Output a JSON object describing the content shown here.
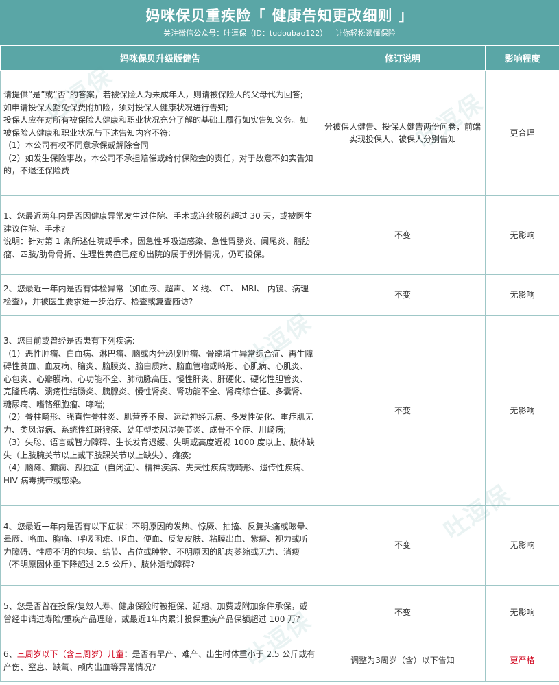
{
  "header": {
    "title": "妈咪保贝重疾险「 健康告知更改细则 」",
    "subtitle_follow": "关注微信公众号：吐逗保（ID：tudoubao122）",
    "subtitle_slogan": "让你轻松读懂保险"
  },
  "table": {
    "columns": [
      "妈咪保贝升级版健告",
      "修订说明",
      "影响程度"
    ],
    "rows": [
      {
        "lines": [
          "请提供“是”或“否”的答案，若被保险人为未成年人，则请被保险人的父母代为回答;",
          "如申请投保人豁免保费附加险，须对投保人健康状况进行告知;",
          "投保人应在对所有被保险人健康和职业状况充分了解的基础上履行如实告知义务。如被保险人健康和职业状况与下述告知内容不符:",
          "（1）本公司有权不同意承保或解除合同",
          "（2）如发生保险事故，本公司不承担赔偿或给付保险金的责任，对于故意不如实告知的，不退还保险费"
        ],
        "note": "分被保人健告、投保人健告两份问卷，前端实现投保人、被保人分别告知",
        "impact": "更合理"
      },
      {
        "lines": [
          "1、您最近两年内是否因健康异常发生过住院、手术或连续服药超过 30 天，或被医生建议住院、手术?",
          "说明：针对第 1 条所述住院或手术，因急性呼吸道感染、急性胃肠炎、阑尾炎、脂肪瘤、四肢/肋骨骨折、生理性黄疸已痊愈出院的属于例外情况，仍可投保。"
        ],
        "note": "不变",
        "impact": "无影响"
      },
      {
        "lines": [
          "2、您最近一年内是否有体检异常（如血液、超声、 X 线、 CT、 MRI、 内镜、病理检查），并被医生要求进一步治疗、检查或复查随访?"
        ],
        "note": "不变",
        "impact": "无影响"
      },
      {
        "lines": [
          "3、您目前或曾经是否患有下列疾病:",
          "（1）恶性肿瘤、白血病、淋巴瘤、脑或内分泌腺肿瘤、骨髓增生异常综合症、再生障碍性贫血、血友病、脑炎、脑膜炎、脑白质病、脑血管瘤或畸形、心肌病、心肌炎、心包炎、心瓣膜病、心功能不全、肺动脉高压、慢性肝炎、肝硬化、硬化性胆管炎、克隆氏病、溃疡性结肠炎、胰腺炎、慢性肾炎、肾功能不全、肾病综合征、多囊肾、糖尿病、嗜铬细胞瘤、哮喘;",
          "（2）脊柱畸形、强直性脊柱炎、肌营养不良、运动神经元病、多发性硬化、重症肌无力、类风湿病、系统性红斑狼疮、幼年型类风湿关节炎、成骨不全症、川崎病;",
          "（3）失聪、语言或智力障碍、生长发育迟缓、失明或高度近视 1000 度以上、肢体缺失（上肢腕关节以上或下肢踝关节以上缺失）、瘫痪;",
          "（4）脑瘫、癫痫、孤独症（自闭症）、精神疾病、先天性疾病或畸形、遗传性疾病、HIV 病毒携带或感染。"
        ],
        "note": "不变",
        "impact": "无影响"
      },
      {
        "lines": [
          "4、您最近一年内是否有以下症状：不明原因的发热、惊厥、抽搐、反复头痛或眩晕、晕厥、咯血、胸痛、呼吸困难、呕血、便血、反复皮肤、粘膜出血、紫癜、视力或听力障碍、性质不明的包块、结节、占位或肿物、不明原因的肌肉萎缩或无力、消瘦（不明原因体重下降超过 2.5 公斤）、肢体活动障碍?"
        ],
        "note": "不变",
        "impact": "无影响"
      },
      {
        "lines": [
          "5、您是否曾在投保/复效人寿、健康保险时被拒保、延期、加费或附加条件承保，或曾经申请过寿险/重疾产品理赔，或最近1年内累计投保重疾产品保额超过 100 万?"
        ],
        "note": "不变",
        "impact": "无影响"
      },
      {
        "prefix": "6、",
        "highlight": "三周岁以下（含三周岁）儿童",
        "rest": "：是否有早产、难产、出生时体重小于 2.5 公斤或有产伤、窒息、缺氧、颅内出血等异常情况?",
        "note": "调整为3周岁（含）以下告知",
        "impact": "更严格"
      }
    ]
  },
  "watermark": "吐逗保",
  "colors": {
    "accent": "#5aa6a6",
    "border": "#9fc7c7",
    "highlight": "#d0021b"
  }
}
